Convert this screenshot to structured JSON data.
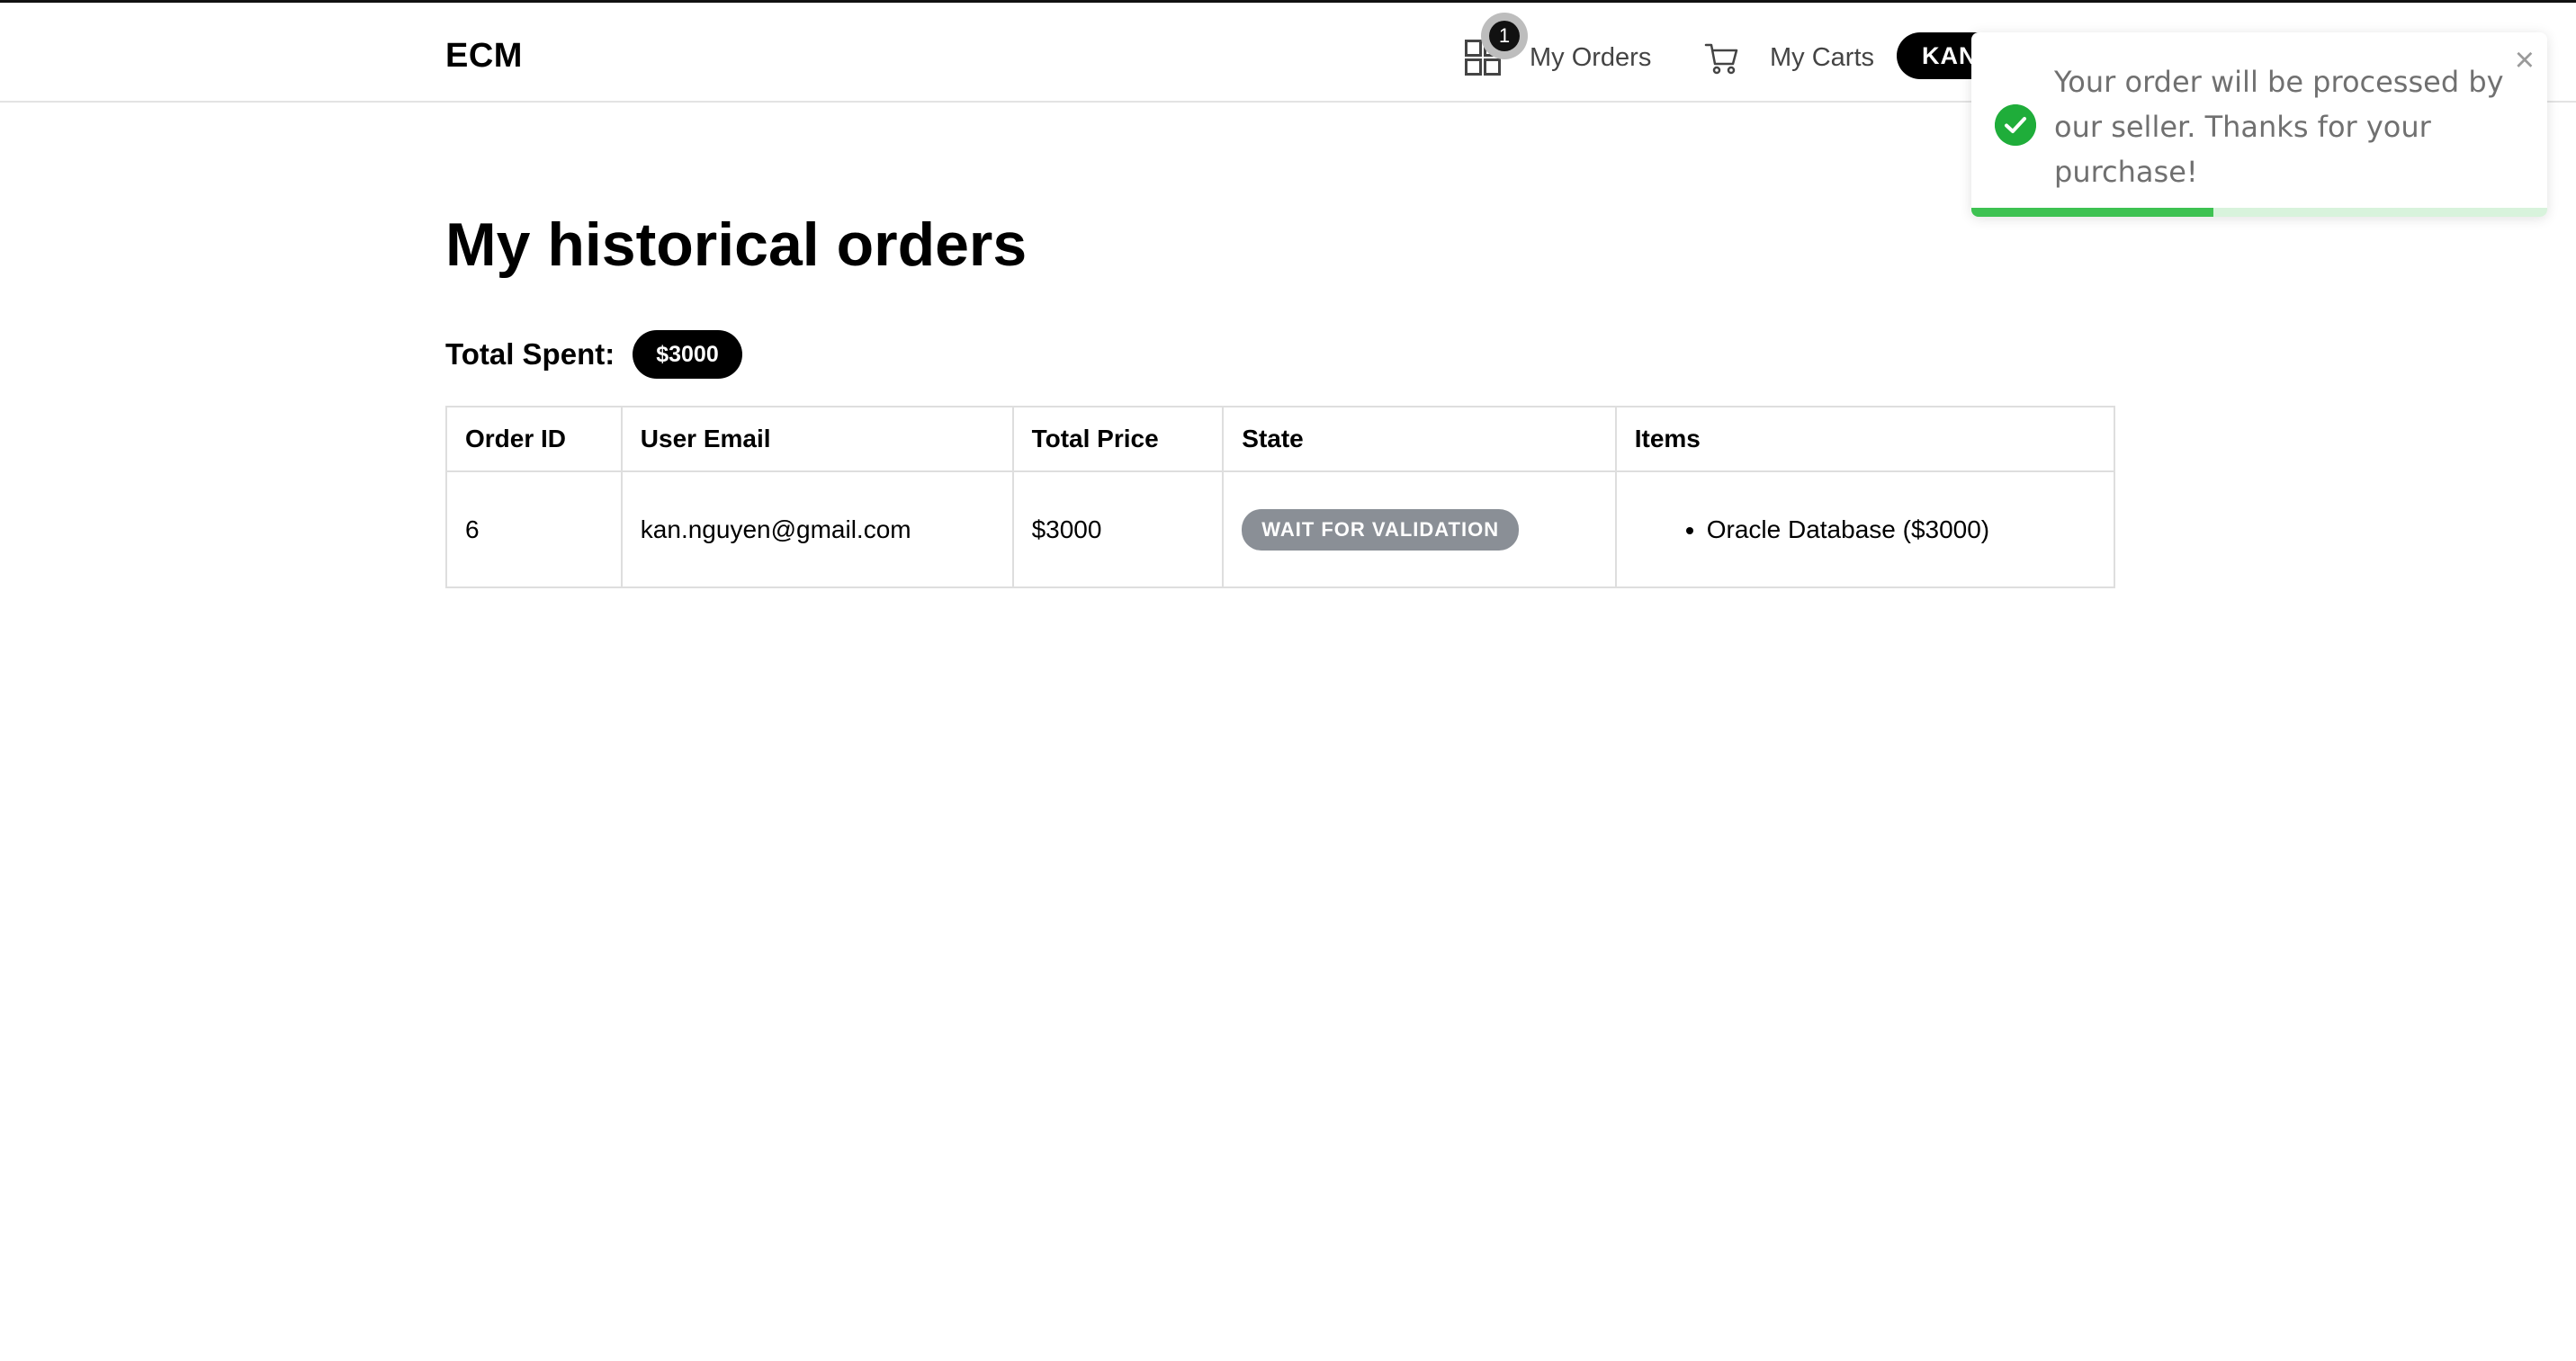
{
  "header": {
    "brand": "ECM",
    "orders_label": "My Orders",
    "orders_badge": "1",
    "carts_label": "My Carts",
    "user_label": "KAN"
  },
  "main": {
    "title": "My historical orders",
    "total_label": "Total Spent:",
    "total_value": "$3000"
  },
  "table": {
    "headers": [
      "Order ID",
      "User Email",
      "Total Price",
      "State",
      "Items"
    ],
    "rows": [
      {
        "order_id": "6",
        "email": "kan.nguyen@gmail.com",
        "total_price": "$3000",
        "state": "WAIT FOR VALIDATION",
        "items": [
          "Oracle Database ($3000)"
        ]
      }
    ]
  },
  "toast": {
    "message": "Your order will be processed by our seller. Thanks for your purchase!",
    "close_symbol": "×",
    "progress_remaining": 0.42
  },
  "colors": {
    "accent": "#000000",
    "success": "#1fad3a",
    "state_badge": "#8a8f96"
  }
}
